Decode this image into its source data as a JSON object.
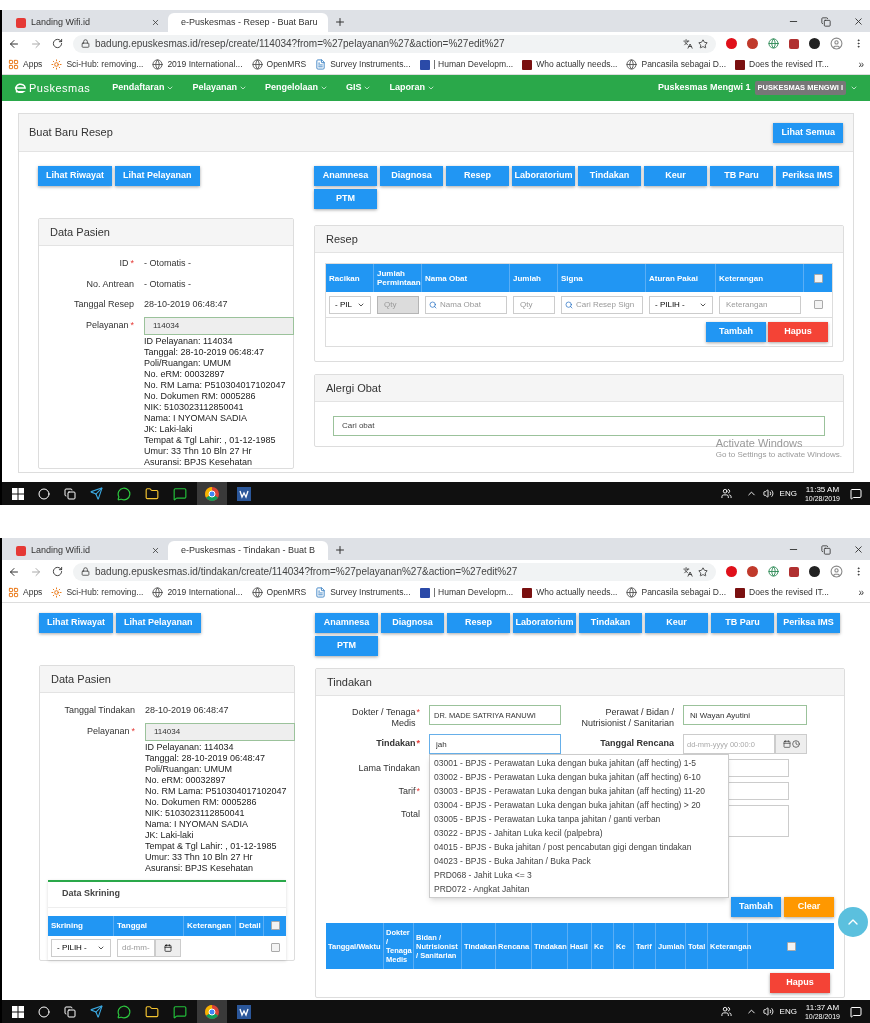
{
  "windows": [
    {
      "kind": "resep",
      "tabs": [
        {
          "title": "Landing Wifi.id",
          "selected": false
        },
        {
          "title": "e-Puskesmas - Resep - Buat Baru",
          "selected": true
        }
      ],
      "url": "badung.epuskesmas.id/resep/create/114034?from=%27pelayanan%27&action=%27edit%27",
      "bookmarks": [
        "Apps",
        "Sci-Hub: removing...",
        "2019 International...",
        "OpenMRS",
        "Survey Instruments...",
        "| Human Developm...",
        "Who actually needs...",
        "Pancasila sebagai D...",
        "Does the revised IT..."
      ],
      "more_bookmarks": "»",
      "navbar": {
        "brand": "Puskesmas",
        "menus": [
          "Pendaftaran",
          "Pelayanan",
          "Pengelolaan",
          "GIS",
          "Laporan"
        ],
        "user": "Puskesmas Mengwi 1",
        "badge": "PUSKESMAS MENGWI I"
      },
      "page": {
        "header": {
          "title": "Buat Baru Resep",
          "button": "Lihat Semua"
        },
        "left_buttons": [
          "Lihat Riwayat",
          "Lihat Pelayanan"
        ],
        "module_buttons": [
          "Anamnesa",
          "Diagnosa",
          "Resep",
          "Laboratorium",
          "Tindakan",
          "Keur",
          "TB Paru",
          "Periksa IMS",
          "PTM"
        ],
        "patient": {
          "title": "Data Pasien",
          "fields": [
            {
              "kind": "text",
              "label": "ID",
              "mark": "*",
              "value": "- Otomatis -"
            },
            {
              "kind": "text",
              "label": "No. Antrean",
              "value": "- Otomatis -"
            },
            {
              "kind": "text",
              "label": "Tanggal Resep",
              "value": "28-10-2019 06:48:47"
            },
            {
              "kind": "input",
              "label": "Pelayanan",
              "mark": "*",
              "value": "114034"
            }
          ],
          "info": [
            "ID Pelayanan: 114034",
            "Tanggal: 28-10-2019 06:48:47",
            "Poli/Ruangan: UMUM",
            "No. eRM: 00032897",
            "No. RM Lama: P510304017102047",
            "No. Dokumen RM: 0005286",
            "NIK: 5103023112850041",
            "Nama: I NYOMAN SADIA",
            "JK: Laki-laki",
            "Tempat & Tgl Lahir: , 01-12-1985",
            "Umur: 33 Thn 10 Bln 27 Hr",
            "Asuransi: BPJS Kesehatan"
          ]
        },
        "resep": {
          "title": "Resep",
          "columns": [
            "Racikan",
            "Jumlah Permintaan",
            "Nama Obat",
            "Jumlah",
            "Signa",
            "Aturan Pakai",
            "Keterangan"
          ],
          "all_checked": false,
          "row": {
            "cells": [
              {
                "kind": "select",
                "value": "- PIL"
              },
              {
                "kind": "input",
                "placeholder": "Qty",
                "disabled": true
              },
              {
                "kind": "search",
                "placeholder": "Nama Obat"
              },
              {
                "kind": "input",
                "placeholder": "Qty",
                "disabled": false
              },
              {
                "kind": "search",
                "placeholder": "Cari Resep Sign"
              },
              {
                "kind": "select",
                "value": "- PILIH -"
              },
              {
                "kind": "input",
                "placeholder": "Keterangan",
                "disabled": false
              }
            ],
            "checked": false
          },
          "buttons": [
            {
              "kind": "primary",
              "label": "Tambah"
            },
            {
              "kind": "danger",
              "label": "Hapus"
            }
          ]
        },
        "alergi": {
          "title": "Alergi Obat",
          "placeholder": "Cari obat"
        }
      },
      "watermark": {
        "title": "Activate Windows",
        "subtitle": "Go to Settings to activate Windows."
      },
      "taskbar": {
        "language": "ENG",
        "time": "11:35 AM",
        "date": "10/28/2019"
      }
    },
    {
      "kind": "tindakan",
      "tabs": [
        {
          "title": "Landing Wifi.id",
          "selected": false
        },
        {
          "title": "e-Puskesmas - Tindakan - Buat B",
          "selected": true
        }
      ],
      "url": "badung.epuskesmas.id/tindakan/create/114034?from=%27pelayanan%27&action=%27edit%27",
      "bookmarks": [
        "Apps",
        "Sci-Hub: removing...",
        "2019 International...",
        "OpenMRS",
        "Survey Instruments...",
        "| Human Developm...",
        "Who actually needs...",
        "Pancasila sebagai D...",
        "Does the revised IT..."
      ],
      "more_bookmarks": "»",
      "page": {
        "left_buttons": [
          "Lihat Riwayat",
          "Lihat Pelayanan"
        ],
        "module_buttons": [
          "Anamnesa",
          "Diagnosa",
          "Resep",
          "Laboratorium",
          "Tindakan",
          "Keur",
          "TB Paru",
          "Periksa IMS",
          "PTM"
        ],
        "patient": {
          "title": "Data Pasien",
          "fields": [
            {
              "kind": "text",
              "label": "Tanggal Tindakan",
              "value": "28-10-2019 06:48:47"
            },
            {
              "kind": "input",
              "label": "Pelayanan",
              "mark": "*",
              "value": "114034"
            }
          ],
          "info": [
            "ID Pelayanan: 114034",
            "Tanggal: 28-10-2019 06:48:47",
            "Poli/Ruangan: UMUM",
            "No. eRM: 00032897",
            "No. RM Lama: P510304017102047",
            "No. Dokumen RM: 0005286",
            "NIK: 5103023112850041",
            "Nama: I NYOMAN SADIA",
            "JK: Laki-laki",
            "Tempat & Tgl Lahir: , 01-12-1985",
            "Umur: 33 Thn 10 Bln 27 Hr",
            "Asuransi: BPJS Kesehatan"
          ]
        },
        "screening": {
          "title": "Data Skrining",
          "columns": [
            "Skrining",
            "Tanggal",
            "Keterangan",
            "Detail"
          ],
          "all_checked": false,
          "row": {
            "select": "- PILIH -",
            "date_placeholder": "dd-mm-",
            "checked": false
          }
        },
        "tindakan": {
          "title": "Tindakan",
          "doctor": {
            "label": "Dokter / Tenaga Medis",
            "mark": "*",
            "value": "DR. MADE SATRIYA RANUWI"
          },
          "nurse": {
            "label": "Perawat / Bidan / Nutrisionist / Sanitarian",
            "value": "Ni Wayan Ayutini"
          },
          "action": {
            "label": "Tindakan",
            "mark": "*",
            "value": "jah"
          },
          "plan_date": {
            "label": "Tanggal Rencana",
            "placeholder": "dd-mm-yyyy 00:00:0"
          },
          "wide_fields": [
            {
              "kind": "input",
              "label": "Lama Tindakan"
            },
            {
              "kind": "input",
              "label": "Tarif",
              "mark": "*"
            },
            {
              "kind": "textarea",
              "label": "Total"
            }
          ],
          "suggestions": [
            "03001 - BPJS - Perawatan Luka dengan buka jahitan (aff hecting) 1-5",
            "03002 - BPJS - Perawatan Luka dengan buka jahitan (aff hecting) 6-10",
            "03003 - BPJS - Perawatan Luka dengan buka jahitan (aff hecting) 11-20",
            "03004 - BPJS - Perawatan Luka dengan buka jahitan (aff hecting) > 20",
            "03005 - BPJS - Perawatan Luka tanpa jahitan / ganti verban",
            "03022 - BPJS - Jahitan Luka kecil (palpebra)",
            "04015 - BPJS - Buka jahitan / post pencabutan gigi dengan tindakan",
            "04023 - BPJS - Buka Jahitan / Buka Pack",
            "PRD068 - Jahit Luka <= 3",
            "PRD072 - Angkat Jahitan"
          ],
          "buttons": [
            {
              "kind": "primary",
              "label": "Tambah"
            },
            {
              "kind": "warning",
              "label": "Clear"
            }
          ],
          "columns": [
            "Tanggal/Waktu",
            "Dokter / Tenaga Medis",
            "Bidan / Nutrisionist / Sanitarian",
            "Tindakan",
            "Rencana",
            "Tindakan",
            "Hasil",
            "Ke",
            "Ke",
            "Tarif",
            "Jumlah",
            "Total",
            "Keterangan"
          ],
          "all_checked": false,
          "delete_button": "Hapus"
        }
      },
      "taskbar": {
        "language": "ENG",
        "time": "11:37 AM",
        "date": "10/28/2019"
      }
    }
  ]
}
